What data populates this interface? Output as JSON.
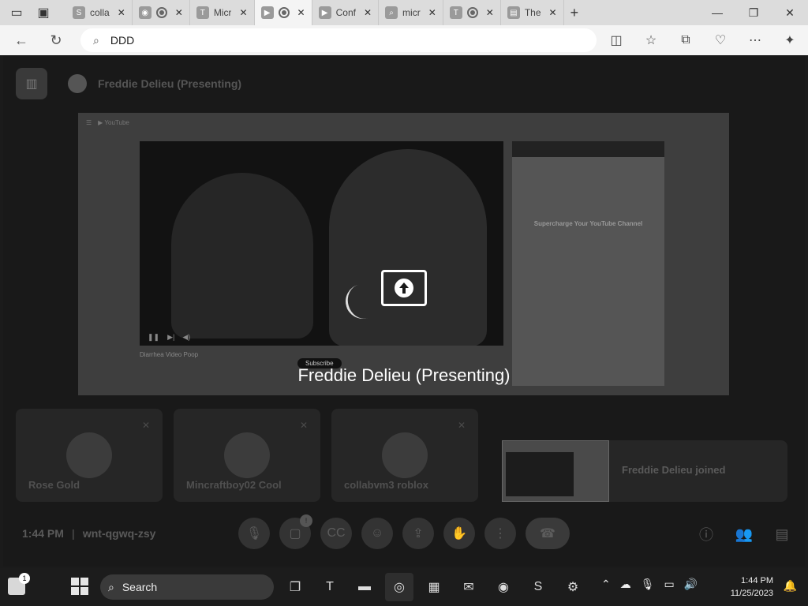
{
  "browser": {
    "tabs": [
      {
        "label": "colla",
        "icon": "S"
      },
      {
        "label": "",
        "icon": "discord"
      },
      {
        "label": "Micr",
        "icon": "teams"
      },
      {
        "label": "",
        "icon": "meet"
      },
      {
        "label": "Conf",
        "icon": "youtube"
      },
      {
        "label": "micr",
        "icon": "search"
      },
      {
        "label": "",
        "icon": "teams"
      },
      {
        "label": "The",
        "icon": "page"
      }
    ],
    "address": "DDD"
  },
  "meet": {
    "presenter_header": "Freddie Delieu (Presenting)",
    "overlay_label": "Freddie Delieu (Presenting)",
    "participants": [
      {
        "name": "Rose Gold"
      },
      {
        "name": "Mincraftboy02 Cool"
      },
      {
        "name": "collabvm3 roblox"
      }
    ],
    "joined_notice": "Freddie Delieu joined",
    "time": "1:44 PM",
    "meeting_code": "wnt-qgwq-zsy",
    "shared_screen": {
      "video_title": "Diarrhea Video Poop",
      "subscribe_label": "Subscribe",
      "promo_text": "Supercharge Your YouTube Channel"
    }
  },
  "taskbar": {
    "search_label": "Search",
    "clock_time": "1:44 PM",
    "clock_date": "11/25/2023",
    "widget_badge": "1"
  }
}
